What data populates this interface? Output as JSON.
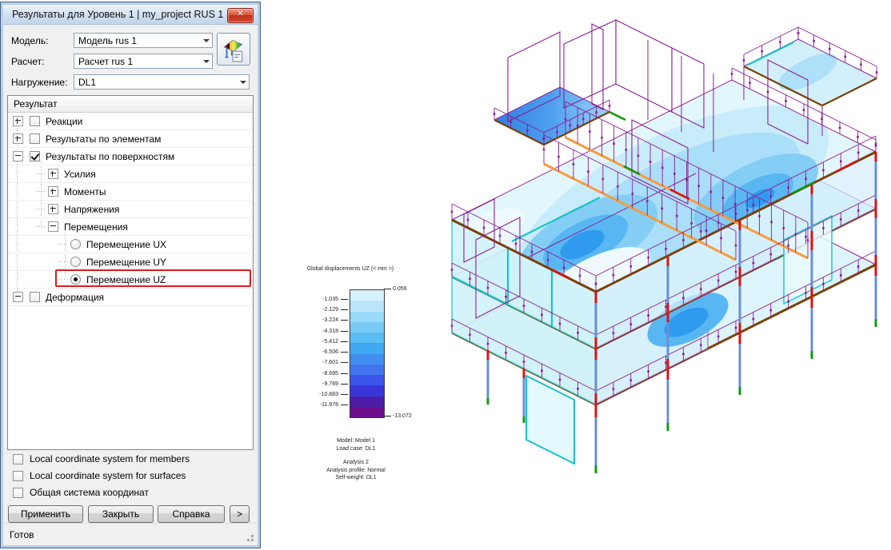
{
  "colors": {
    "titlebar": "#cfdef0",
    "close_button": "#c0301a",
    "highlight_box": "#d61f1f",
    "model": {
      "wire": "#8b1e96",
      "edge": "#7a4106",
      "orange": "#f79b3e",
      "cyan": "#1bc2c8",
      "red": "#dd1111",
      "green": "#0f9a10",
      "bluecol": "#6a8ed6"
    }
  },
  "panel": {
    "title": "Результаты для Уровень 1 | my_project RUS 1",
    "fields": [
      {
        "label": "Модель:",
        "value": "Модель rus 1"
      },
      {
        "label": "Расчет:",
        "value": "Расчет rus 1"
      },
      {
        "label": "Нагружение:",
        "value": "DL1"
      }
    ],
    "tree": {
      "header": "Результат",
      "items": [
        {
          "label": "Реакции"
        },
        {
          "label": "Результаты по элементам"
        },
        {
          "label": "Результаты по поверхностям"
        },
        {
          "label": "Усилия"
        },
        {
          "label": "Моменты"
        },
        {
          "label": "Напряжения"
        },
        {
          "label": "Перемещения"
        },
        {
          "label": "Перемещение UX"
        },
        {
          "label": "Перемещение UY"
        },
        {
          "label": "Перемещение UZ"
        },
        {
          "label": "Деформация"
        }
      ]
    },
    "options": [
      "Local coordinate system for members",
      "Local coordinate system for surfaces",
      "Общая система координат"
    ],
    "buttons": {
      "apply": "Применить",
      "close": "Закрыть",
      "help": "Справка",
      "more": ">"
    },
    "status": "Готов"
  },
  "legend": {
    "title": "Global displacements UZ (< mm >)",
    "max_label": "0.059",
    "min_label": "-13.072",
    "ticks": [
      "-1.035",
      "-2.129",
      "-3.224",
      "-4.318",
      "-5.412",
      "-6.506",
      "-7.601",
      "-8.695",
      "-9.789",
      "-10.883",
      "-11.978"
    ],
    "colors": [
      "#d7f1fc",
      "#bae5fa",
      "#9bd9f8",
      "#79cbf6",
      "#5abdf4",
      "#3fa9f2",
      "#418ff1",
      "#4274ef",
      "#3d55e9",
      "#3a35d9",
      "#4a1ea6",
      "#6e0d8c"
    ]
  },
  "info": {
    "model": "Model: Model 1",
    "load_case": "Load case: DL1",
    "analysis": "Analysis 2",
    "profile": "Analysis profile: Normal",
    "self_weight": "Self-weight: DL1"
  }
}
